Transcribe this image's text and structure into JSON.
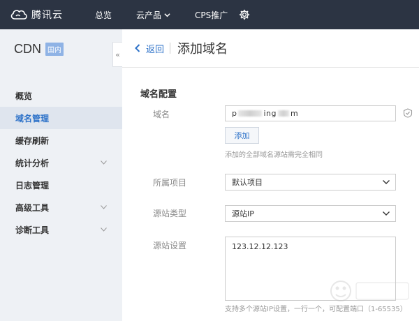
{
  "topbar": {
    "brand": "腾讯云",
    "nav": {
      "overview": "总览",
      "products": "云产品",
      "cps": "CPS推广"
    },
    "icons": [
      "cloud-logo-icon",
      "chevron-down-icon",
      "gear-icon"
    ]
  },
  "sidebar": {
    "title": "CDN",
    "badge": "国内",
    "collapse_glyph": "«",
    "items": [
      {
        "label": "概览",
        "active": false,
        "has_children": false
      },
      {
        "label": "域名管理",
        "active": true,
        "has_children": false
      },
      {
        "label": "缓存刷新",
        "active": false,
        "has_children": false
      },
      {
        "label": "统计分析",
        "active": false,
        "has_children": true
      },
      {
        "label": "日志管理",
        "active": false,
        "has_children": false
      },
      {
        "label": "高级工具",
        "active": false,
        "has_children": true
      },
      {
        "label": "诊断工具",
        "active": false,
        "has_children": true
      }
    ]
  },
  "main": {
    "back_label": "返回",
    "page_title": "添加域名",
    "section_title": "域名配置",
    "domain": {
      "label": "域名",
      "value_prefix": "p",
      "value_middle": "ing",
      "value_suffix": "m",
      "add_button": "添加",
      "hint": "添加的全部域名源站需完全相同"
    },
    "project": {
      "label": "所属项目",
      "selected": "默认项目"
    },
    "origin_type": {
      "label": "源站类型",
      "selected": "源站IP"
    },
    "origin_settings": {
      "label": "源站设置",
      "value": "123.12.12.123",
      "hint": "支持多个源站IP设置，一行一个，可配置端口（1-65535）"
    }
  },
  "colors": {
    "topbar": "#2c3443",
    "sidebar": "#eef1f5",
    "accent": "#2f73c9",
    "badge": "#8fb3e5"
  }
}
